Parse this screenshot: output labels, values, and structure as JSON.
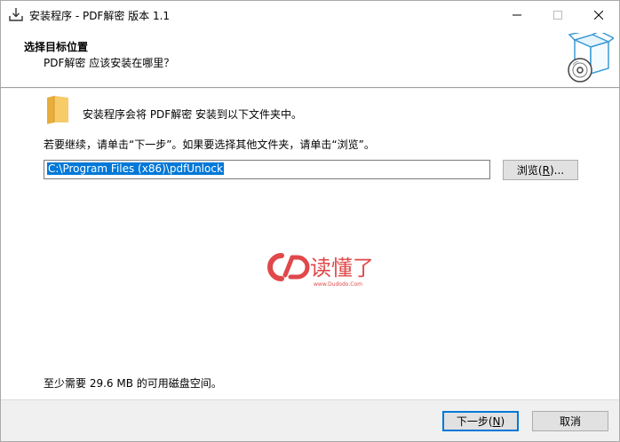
{
  "window": {
    "title": "安装程序 - PDF解密 版本 1.1"
  },
  "header": {
    "title": "选择目标位置",
    "subtitle": "PDF解密 应该安装在哪里？"
  },
  "body": {
    "install_info": "安装程序会将 PDF解密 安装到以下文件夹中。",
    "continue_info": "若要继续，请单击“下一步”。如果要选择其他文件夹，请单击“浏览”。",
    "install_path": "C:\\Program Files (x86)\\pdfUnlock",
    "browse_label": "浏览",
    "browse_key": "R",
    "space_info": "至少需要 29.6 MB 的可用磁盘空间。"
  },
  "watermark": {
    "text": "读懂了",
    "url": "www.Dudodo.Com"
  },
  "footer": {
    "next_label": "下一步",
    "next_key": "N",
    "cancel_label": "取消"
  },
  "colors": {
    "accent": "#0078d7",
    "folder": "#f3c25e",
    "watermark": "#e0484a"
  }
}
